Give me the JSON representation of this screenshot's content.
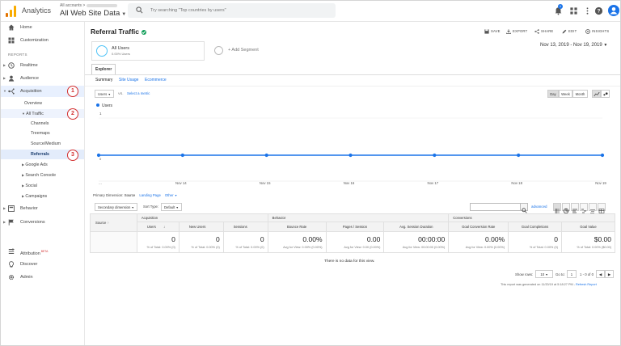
{
  "topbar": {
    "app_name": "Analytics",
    "account_label": "All accounts",
    "view_name": "All Web Site Data",
    "search_placeholder": "Try searching \"Top countries by users\"",
    "notification_count": "1"
  },
  "sidebar": {
    "reports_label": "REPORTS",
    "items": [
      {
        "label": "Home",
        "icon": "home-icon"
      },
      {
        "label": "Customization",
        "icon": "grid-icon"
      },
      {
        "label": "Realtime",
        "icon": "clock-icon"
      },
      {
        "label": "Audience",
        "icon": "person-icon"
      },
      {
        "label": "Acquisition",
        "icon": "acquisition-icon"
      },
      {
        "label": "Behavior",
        "icon": "behavior-icon"
      },
      {
        "label": "Conversions",
        "icon": "flag-icon"
      }
    ],
    "acquisition_sub": {
      "overview": "Overview",
      "all_traffic": "All Traffic",
      "channels": "Channels",
      "treemaps": "Treemaps",
      "source_medium": "Source/Medium",
      "referrals": "Referrals",
      "google_ads": "Google Ads",
      "search_console": "Search Console",
      "social": "Social",
      "campaigns": "Campaigns"
    },
    "bottom": {
      "attribution": "Attribution",
      "attribution_badge": "BETA",
      "discover": "Discover",
      "admin": "Admin"
    },
    "callouts": [
      "1",
      "2",
      "3"
    ]
  },
  "header": {
    "title": "Referral Traffic",
    "actions": [
      "SAVE",
      "EXPORT",
      "SHARE",
      "EDIT",
      "INSIGHTS"
    ],
    "date_range": "Nov 13, 2019 - Nov 19, 2019"
  },
  "segments": {
    "active_name": "All Users",
    "active_sub": "0.00% Users",
    "add_label": "+ Add Segment"
  },
  "explorer": {
    "tab": "Explorer",
    "subtabs": [
      "Summary",
      "Site Usage",
      "Ecommerce"
    ],
    "metric": "Users",
    "vs": "VS.",
    "select_metric": "Select a metric",
    "granularity": [
      "Day",
      "Week",
      "Month"
    ]
  },
  "chart_data": {
    "type": "line",
    "legend": "Users",
    "y_tick_top": "1",
    "y_tick_bottom": "0",
    "categories": [
      "...",
      "Nov 14",
      "Nov 15",
      "Nov 16",
      "Nov 17",
      "Nov 18",
      "Nov 19"
    ],
    "series": [
      {
        "name": "Users",
        "values": [
          0,
          0,
          0,
          0,
          0,
          0,
          0
        ]
      }
    ],
    "ylim": [
      0,
      1
    ],
    "color": "#1a73e8"
  },
  "table": {
    "primary_dimension_label": "Primary Dimension:",
    "primary_dimension": "Source",
    "landing_page": "Landing Page",
    "other": "Other",
    "secondary_dimension": "Secondary dimension",
    "sort_type_label": "Sort Type:",
    "sort_type": "Default",
    "advanced": "advanced",
    "groups": [
      "Acquisition",
      "Behavior",
      "Conversions"
    ],
    "source_header": "Source",
    "columns": [
      "Users",
      "New Users",
      "Sessions",
      "Bounce Rate",
      "Pages / Session",
      "Avg. Session Duration",
      "Goal Conversion Rate",
      "Goal Completions",
      "Goal Value"
    ],
    "totals": [
      {
        "value": "0",
        "sub": "% of Total: 0.00% (0)"
      },
      {
        "value": "0",
        "sub": "% of Total: 0.00% (0)"
      },
      {
        "value": "0",
        "sub": "% of Total: 0.00% (0)"
      },
      {
        "value": "0.00%",
        "sub": "Avg for View: 0.00% (0.00%)"
      },
      {
        "value": "0.00",
        "sub": "Avg for View: 0.00 (0.00%)"
      },
      {
        "value": "00:00:00",
        "sub": "Avg for View: 00:00:00 (0.00%)"
      },
      {
        "value": "0.00%",
        "sub": "Avg for View: 0.00% (0.00%)"
      },
      {
        "value": "0",
        "sub": "% of Total: 0.00% (0)"
      },
      {
        "value": "$0.00",
        "sub": "% of Total: 0.00% ($0.00)"
      }
    ],
    "no_data": "There is no data for this view."
  },
  "pagination": {
    "show_rows_label": "Show rows:",
    "rows": "10",
    "goto_label": "Go to:",
    "goto_value": "1",
    "range": "1 - 0 of 0"
  },
  "footer": {
    "generated": "This report was generated on 11/20/19 at 5:18:27 PM -",
    "refresh": "Refresh Report"
  }
}
